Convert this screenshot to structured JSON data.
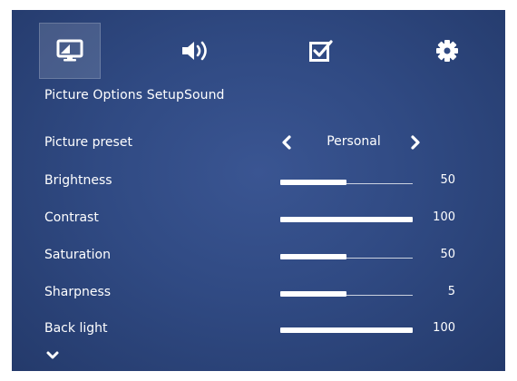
{
  "tabs": [
    {
      "icon": "picture-monitor-icon",
      "active": true
    },
    {
      "icon": "speaker-volume-icon",
      "active": false
    },
    {
      "icon": "checkbox-check-icon",
      "active": false
    },
    {
      "icon": "gear-icon",
      "active": false
    }
  ],
  "tab_labels": {
    "picture": "Picture",
    "options": "Options",
    "setup": "Setup",
    "sound": "Sound"
  },
  "settings": {
    "picture_preset": {
      "label": "Picture preset",
      "value": "Personal"
    },
    "brightness": {
      "label": "Brightness",
      "value": "50",
      "level": 0.5
    },
    "contrast": {
      "label": "Contrast",
      "value": "100",
      "level": 1.0
    },
    "saturation": {
      "label": "Saturation",
      "value": "50",
      "level": 0.5
    },
    "sharpness": {
      "label": "Sharpness",
      "value": "5",
      "level": 0.5
    },
    "back_light": {
      "label": "Back light",
      "value": "100",
      "level": 1.0
    }
  },
  "colors": {
    "background": "#304a83",
    "text": "#ffffff"
  }
}
